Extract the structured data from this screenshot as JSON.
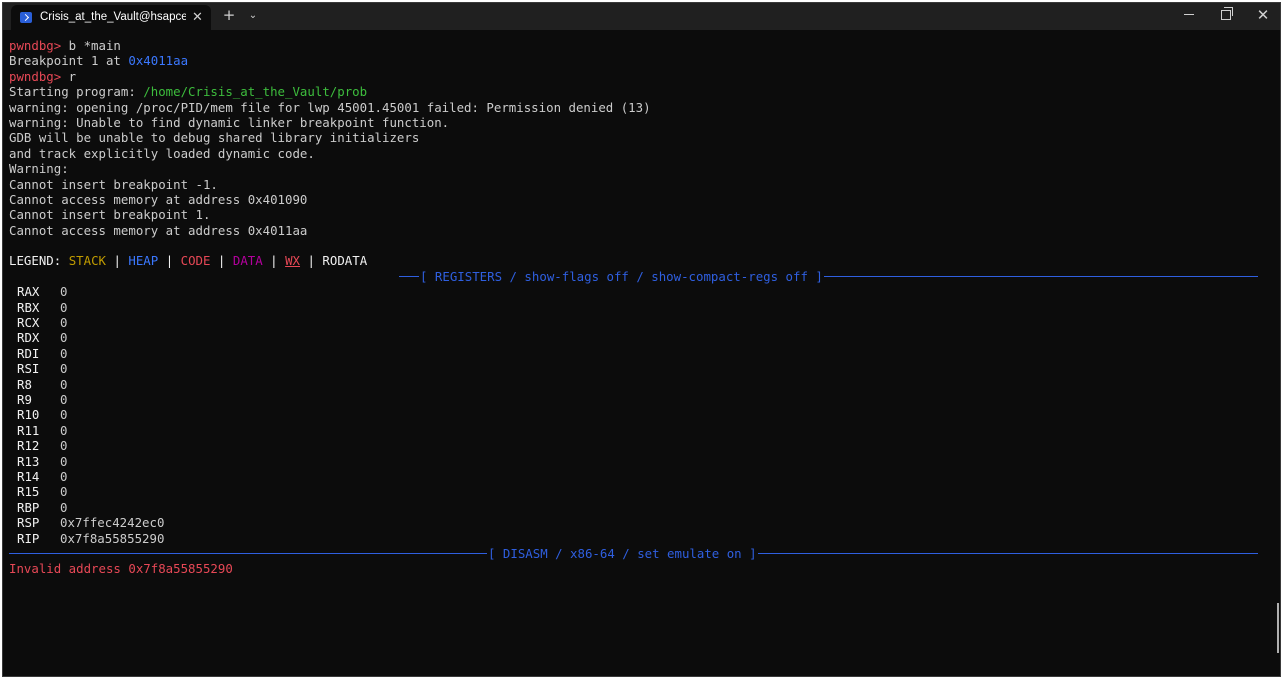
{
  "window": {
    "tab_title": "Crisis_at_the_Vault@hsapce-ic",
    "tab_close": "✕",
    "new_tab": "+",
    "tab_dropdown": "⌄",
    "close": "✕"
  },
  "terminal": {
    "prompt": "pwndbg>",
    "cmd1": " b *main",
    "bp_text": "Breakpoint 1 at ",
    "bp_addr": "0x4011aa",
    "cmd2": " r",
    "start_text": "Starting program: ",
    "program_path": "/home/Crisis_at_the_Vault/prob",
    "messages": [
      "warning: opening /proc/PID/mem file for lwp 45001.45001 failed: Permission denied (13)",
      "warning: Unable to find dynamic linker breakpoint function.",
      "GDB will be unable to debug shared library initializers",
      "and track explicitly loaded dynamic code.",
      "Warning:",
      "Cannot insert breakpoint -1.",
      "Cannot access memory at address 0x401090",
      "Cannot insert breakpoint 1.",
      "Cannot access memory at address 0x4011aa"
    ],
    "legend": {
      "label": "LEGEND: ",
      "stack": "STACK",
      "heap": "HEAP",
      "code": "CODE",
      "data": "DATA",
      "wx": "WX",
      "rodata": "RODATA",
      "sep": " | "
    },
    "registers_header": "[ REGISTERS / show-flags off / show-compact-regs off ]",
    "registers": [
      {
        "name": "RAX",
        "value": "0"
      },
      {
        "name": "RBX",
        "value": "0"
      },
      {
        "name": "RCX",
        "value": "0"
      },
      {
        "name": "RDX",
        "value": "0"
      },
      {
        "name": "RDI",
        "value": "0"
      },
      {
        "name": "RSI",
        "value": "0"
      },
      {
        "name": "R8",
        "value": "0"
      },
      {
        "name": "R9",
        "value": "0"
      },
      {
        "name": "R10",
        "value": "0"
      },
      {
        "name": "R11",
        "value": "0"
      },
      {
        "name": "R12",
        "value": "0"
      },
      {
        "name": "R13",
        "value": "0"
      },
      {
        "name": "R14",
        "value": "0"
      },
      {
        "name": "R15",
        "value": "0"
      },
      {
        "name": "RBP",
        "value": "0"
      },
      {
        "name": "RSP",
        "value": "0x7ffec4242ec0"
      },
      {
        "name": "RIP",
        "value": "0x7f8a55855290"
      }
    ],
    "disasm_header": "[ DISASM / x86-64 / set emulate on ]",
    "invalid_address": "Invalid address 0x7f8a55855290"
  },
  "colors": {
    "background": "#0c0c0c",
    "prompt_red": "#e74856",
    "address_blue": "#3b78ff",
    "path_green": "#3dbd3d",
    "stack_yellow": "#c19c00",
    "data_magenta": "#b4009e",
    "separator_blue": "#2f5fe0"
  }
}
